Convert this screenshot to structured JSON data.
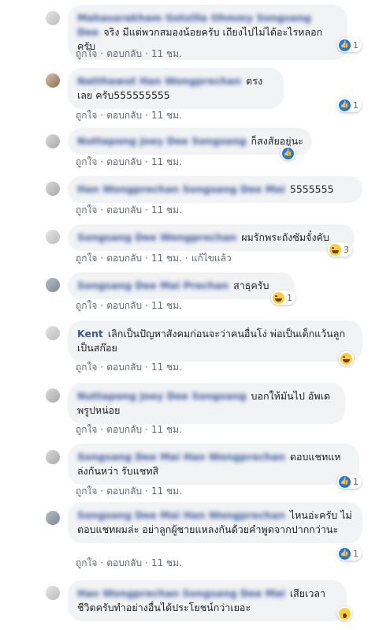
{
  "comments": [
    {
      "name": "Mahasarakham Gotzilla Ohmmy Songsang Dee",
      "text": "จริง มีแต่พวกสมองน้อยครับ เถียงไปไม่ได้อะไรหลอกครับ",
      "meta": {
        "like": "ถูกใจ",
        "reply": "ตอบกลับ",
        "time": "11 ชม."
      },
      "reaction": {
        "type": "like",
        "count": "1"
      }
    },
    {
      "name": "Natthawut Han Wongprechan",
      "text": "ตรงเลย ครับ555555555",
      "meta": {
        "like": "ถูกใจ",
        "reply": "ตอบกลับ",
        "time": "11 ชม."
      },
      "reaction": {
        "type": "like",
        "count": "1"
      }
    },
    {
      "name": "Nuttapong Joey Dee Songsang",
      "text": "ก็สงสัยอยู่นะ",
      "meta": {
        "like": "ถูกใจ",
        "reply": "ตอบกลับ",
        "time": "11 ชม."
      },
      "reaction": {
        "type": "like",
        "count": ""
      }
    },
    {
      "name": "Han Wongprechan Songsang Dee Mai",
      "text": "5555555",
      "meta": {
        "like": "ถูกใจ",
        "reply": "ตอบกลับ",
        "time": "11 ชม."
      },
      "reaction": null
    },
    {
      "name": "Songsang Dee Wongprechan",
      "text": "ผมรักพระถังซัมจั๋งคับ",
      "meta": {
        "like": "ถูกใจ",
        "reply": "ตอบกลับ",
        "time": "11 ชม.",
        "edited": "แก้ไขแล้ว"
      },
      "reaction": {
        "type": "haha",
        "count": "3"
      }
    },
    {
      "name": "Songsang Dee Mai Prechan",
      "text": "สาธุครับ",
      "meta": {
        "like": "ถูกใจ",
        "reply": "ตอบกลับ",
        "time": "11 ชม."
      },
      "reaction": {
        "type": "haha",
        "count": "1"
      }
    },
    {
      "name": "Kent",
      "text": "เลิกเป็นปัญหาสังคมก่อนจะว่าคนอื่นโง่ พ่อเป็นเด็กแว้นลูกเป็นสก๊อย",
      "meta": {
        "like": "ถูกใจ",
        "reply": "ตอบกลับ",
        "time": "11 ชม."
      },
      "reaction": {
        "type": "haha",
        "count": ""
      }
    },
    {
      "name": "Nuttapong Joey Dee Songsang",
      "text": "บอกให้มันไป อัพเดพรูปหน่อย",
      "meta": {
        "like": "ถูกใจ",
        "reply": "ตอบกลับ",
        "time": "11 ชม."
      },
      "reaction": null
    },
    {
      "name": "Songsang Dee Mai Han Wongprechan",
      "text": "ตอบแชทแห ล่งกันหว่า รับแชทสิ",
      "meta": {
        "like": "ถูกใจ",
        "reply": "ตอบกลับ",
        "time": "11 ชม."
      },
      "reaction": {
        "type": "like",
        "count": "1"
      }
    },
    {
      "name": "Songsang Dee Mai Han Wongprechan",
      "text": "ไหนอ่ะครับ ไม่ตอบแชทผมล่ะ อย่าลูกผู้ชายแหลงกันด้วยคำพูดจากปากกว่านะ",
      "meta": {
        "like": "ถูกใจ",
        "reply": "ตอบกลับ",
        "time": "11 ชม."
      },
      "reaction": {
        "type": "like",
        "count": "1"
      }
    },
    {
      "name": "Han Wongprechan Songsang Dee Mai",
      "text": "เสียเวลา ชีวิตครับทำอย่างอื่นได้ประโยชน์กว่าเยอะ",
      "meta": {
        "like": "ถูกใจ",
        "reply": "ตอบกลับ",
        "time": "11 ชม."
      },
      "reaction": {
        "type": "wow",
        "count": ""
      }
    }
  ]
}
